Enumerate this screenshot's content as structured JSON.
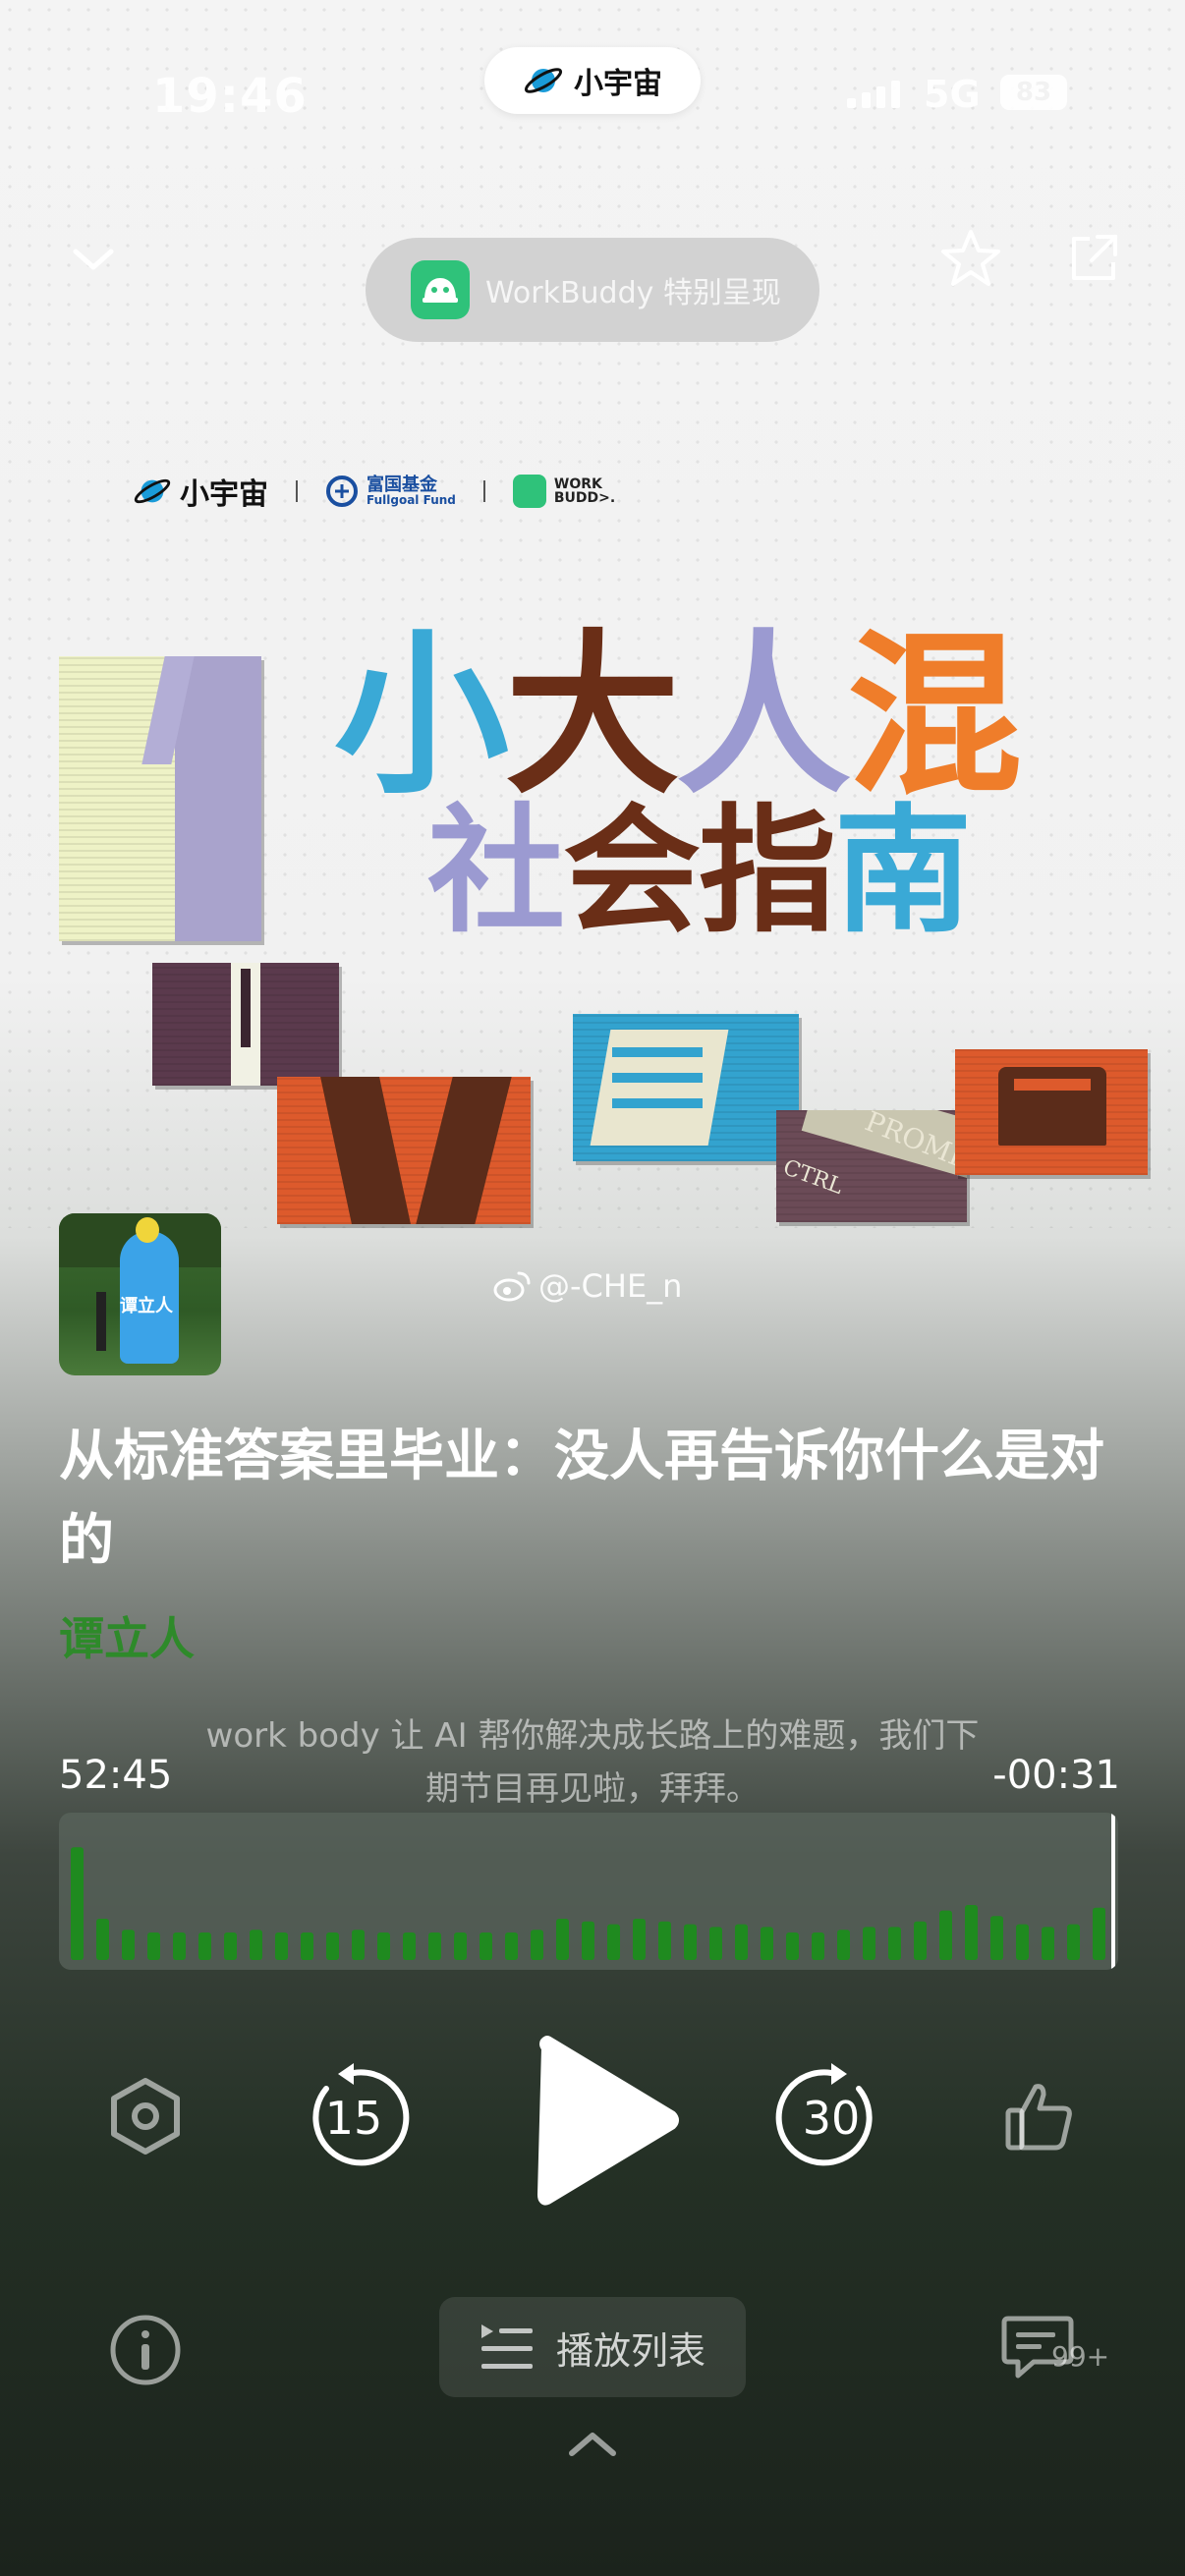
{
  "status_bar": {
    "time": "19:46",
    "app_pill_label": "小宇宙",
    "network": "5G",
    "battery": "83"
  },
  "header": {
    "sponsor_text": "WorkBuddy 特别呈现"
  },
  "cover": {
    "logos": {
      "brand1": "小宇宙",
      "brand2_cn": "富国基金",
      "brand2_en": "Fullgoal Fund",
      "brand3_line1": "WORK",
      "brand3_line2": "BUDD>."
    },
    "title_line1": [
      "小",
      "大",
      "人",
      "混"
    ],
    "title_line2": [
      "社",
      "会",
      "指",
      "南"
    ],
    "tile_words": [
      "PROMP",
      "CTRL"
    ]
  },
  "author_avatar_caption": "谭立人",
  "weibo_handle": "@-CHE_n",
  "episode": {
    "title": "从标准答案里毕业：没人再告诉你什么是对的",
    "host": "谭立人"
  },
  "lyric": "work body 让 AI 帮你解决成长路上的难题，我们下期节目再见啦，拜拜。",
  "player": {
    "elapsed": "52:45",
    "remaining": "-00:31",
    "progress": 0.99,
    "waveform_levels": [
      0.82,
      0.3,
      0.22,
      0.2,
      0.2,
      0.2,
      0.2,
      0.22,
      0.2,
      0.2,
      0.2,
      0.22,
      0.2,
      0.2,
      0.2,
      0.2,
      0.2,
      0.2,
      0.22,
      0.3,
      0.28,
      0.26,
      0.3,
      0.28,
      0.26,
      0.24,
      0.26,
      0.24,
      0.2,
      0.2,
      0.22,
      0.24,
      0.24,
      0.28,
      0.36,
      0.4,
      0.32,
      0.26,
      0.24,
      0.26,
      0.38,
      0.3
    ],
    "rewind_seconds": "15",
    "forward_seconds": "30"
  },
  "bottom": {
    "playlist_label": "播放列表",
    "comment_count": "99+"
  },
  "colors": {
    "host_green": "#2e8a2a",
    "wave_green": "#1f8a1f",
    "accent_blue": "#3aa9d6",
    "accent_brown": "#6a2e17",
    "accent_purple": "#9b9ad1",
    "accent_orange": "#ef7d2a"
  },
  "icons": {
    "collapse": "chevron-down-icon",
    "favorite": "star-icon",
    "share": "share-icon",
    "speed": "hexagon-settings-icon",
    "rewind": "rewind-15-icon",
    "play": "play-icon",
    "forward": "forward-30-icon",
    "like": "thumbs-up-icon",
    "info": "info-icon",
    "playlist": "playlist-icon",
    "comments": "comment-icon",
    "expand": "chevron-up-icon"
  }
}
